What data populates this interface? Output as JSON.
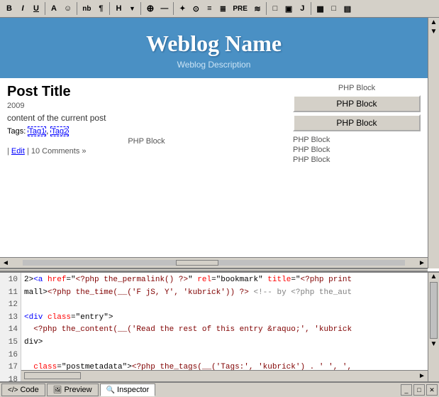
{
  "toolbar": {
    "buttons": [
      "B",
      "I",
      "U",
      "A",
      "☺",
      "nb",
      "¶",
      "H",
      "▼",
      "⊕",
      "—",
      "✦",
      "⊙",
      "≡",
      "≣",
      "PRE",
      "≋",
      "□",
      "▣",
      "J",
      "▦",
      "□",
      "▤"
    ]
  },
  "blog": {
    "title": "Weblog Name",
    "description": "Weblog Description"
  },
  "php_blocks": {
    "top_label": "PHP Block",
    "button1": "PHP Block",
    "button2": "PHP Block",
    "right_labels": [
      "PHP Block",
      "PHP Block",
      "PHP Block"
    ]
  },
  "post": {
    "title": "Post Title",
    "date": "2009",
    "content": "content of the current post",
    "tags_label": "Tags:",
    "tag1": "Tag1",
    "tag2": "Tag2",
    "php_block_label": "PHP Block",
    "meta": "| Edit | 10 Comments &#187;"
  },
  "code": {
    "lines": [
      {
        "num": "10",
        "content": "2><a href=\"<?php the_permalink() ?>\" rel=\"bookmark\" title=\"<?php print"
      },
      {
        "num": "11",
        "content": "mall><?php the_time(__(&#39;F jS, Y&#39;, &#39;kubrick&#39;)) ?> <!-- by <?php the_aut"
      },
      {
        "num": "12",
        "content": ""
      },
      {
        "num": "13",
        "content": "<div class=\"entry\">"
      },
      {
        "num": "14",
        "content": "  <?php the_content(__(&#39;Read the rest of this entry &raquo;&#39;, &#39;kubrick"
      },
      {
        "num": "15",
        "content": "div>"
      },
      {
        "num": "16",
        "content": ""
      },
      {
        "num": "17",
        "content": "  class=\"postmetadata\"><?php the_tags(__(&#39;Tags:&#39;, &#39;kubrick&#39;) . &#39; &#39;, &#39;,"
      }
    ]
  },
  "tabs": {
    "code": "Code",
    "preview": "Preview",
    "inspector": "Inspector"
  }
}
